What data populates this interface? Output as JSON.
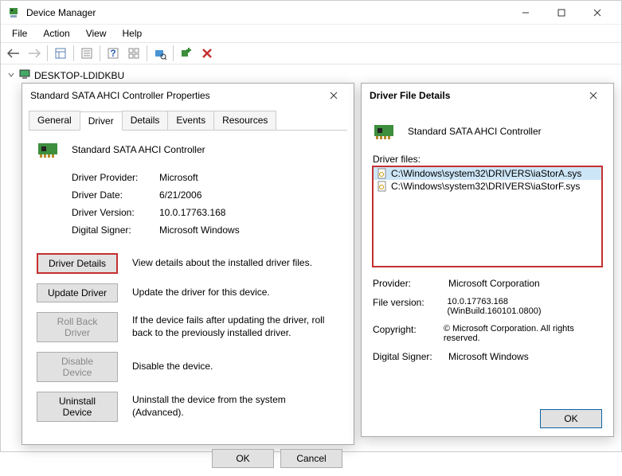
{
  "window": {
    "title": "Device Manager",
    "menus": [
      "File",
      "Action",
      "View",
      "Help"
    ]
  },
  "tree": {
    "root": "DESKTOP-LDIDKBU"
  },
  "props": {
    "title": "Standard SATA AHCI Controller Properties",
    "tabs": [
      "General",
      "Driver",
      "Details",
      "Events",
      "Resources"
    ],
    "device_name": "Standard SATA AHCI Controller",
    "info": {
      "provider_label": "Driver Provider:",
      "provider_value": "Microsoft",
      "date_label": "Driver Date:",
      "date_value": "6/21/2006",
      "version_label": "Driver Version:",
      "version_value": "10.0.17763.168",
      "signer_label": "Digital Signer:",
      "signer_value": "Microsoft Windows"
    },
    "actions": {
      "details_btn": "Driver Details",
      "details_desc": "View details about the installed driver files.",
      "update_btn": "Update Driver",
      "update_desc": "Update the driver for this device.",
      "rollback_btn": "Roll Back Driver",
      "rollback_desc": "If the device fails after updating the driver, roll back to the previously installed driver.",
      "disable_btn": "Disable Device",
      "disable_desc": "Disable the device.",
      "uninstall_btn": "Uninstall Device",
      "uninstall_desc": "Uninstall the device from the system (Advanced)."
    },
    "ok": "OK",
    "cancel": "Cancel"
  },
  "details": {
    "title": "Driver File Details",
    "device_name": "Standard SATA AHCI Controller",
    "files_label": "Driver files:",
    "files": [
      "C:\\Windows\\system32\\DRIVERS\\iaStorA.sys",
      "C:\\Windows\\system32\\DRIVERS\\iaStorF.sys"
    ],
    "provider_label": "Provider:",
    "provider_value": "Microsoft Corporation",
    "fileversion_label": "File version:",
    "fileversion_value": "10.0.17763.168 (WinBuild.160101.0800)",
    "copyright_label": "Copyright:",
    "copyright_value": "© Microsoft Corporation. All rights reserved.",
    "signer_label": "Digital Signer:",
    "signer_value": "Microsoft Windows",
    "ok": "OK"
  }
}
